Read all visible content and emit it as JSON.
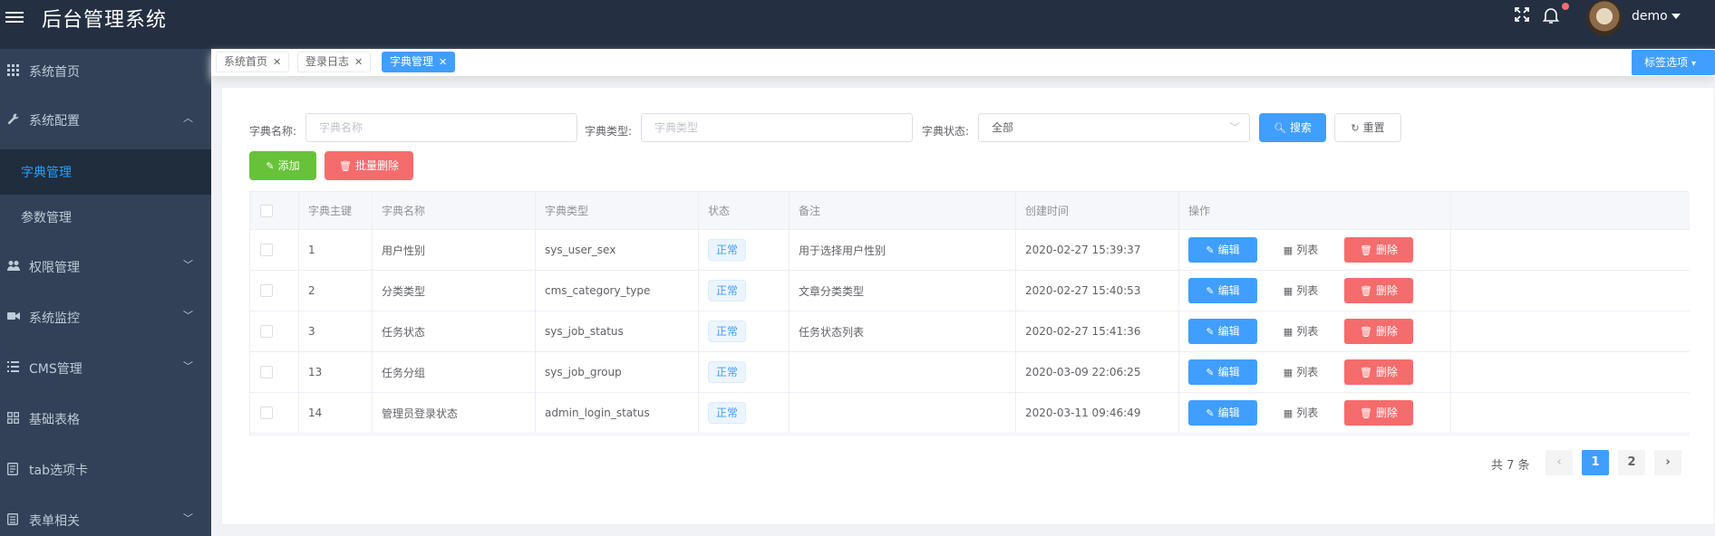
{
  "header": {
    "title": "后台管理系统",
    "username": "demo",
    "icons": [
      "menu-toggle-icon",
      "fullscreen-icon",
      "bell-icon",
      "avatar"
    ]
  },
  "sidebar": {
    "items": [
      {
        "label": "系统首页",
        "icon": "grid-icon"
      },
      {
        "label": "系统配置",
        "icon": "wrench-icon"
      },
      {
        "label": "字典管理"
      },
      {
        "label": "参数管理"
      },
      {
        "label": "权限管理",
        "icon": "users-icon"
      },
      {
        "label": "系统监控",
        "icon": "camera-icon"
      },
      {
        "label": "CMS管理",
        "icon": "list-icon"
      },
      {
        "label": "基础表格",
        "icon": "table-icon"
      },
      {
        "label": "tab选项卡",
        "icon": "document-icon"
      },
      {
        "label": "表单相关",
        "icon": "form-icon"
      }
    ]
  },
  "tags": {
    "items": [
      {
        "label": "系统首页"
      },
      {
        "label": "登录日志"
      },
      {
        "label": "字典管理"
      }
    ],
    "options_label": "标签选项"
  },
  "filters": {
    "name_label": "字典名称:",
    "name_placeholder": "字典名称",
    "type_label": "字典类型:",
    "type_placeholder": "字典类型",
    "status_label": "字典状态:",
    "status_value": "全部",
    "search_label": "搜索",
    "reset_label": "重置"
  },
  "actions": {
    "add_label": "添加",
    "batch_delete_label": "批量删除"
  },
  "table": {
    "headers": [
      "字典主键",
      "字典名称",
      "字典类型",
      "状态",
      "备注",
      "创建时间",
      "操作"
    ],
    "rows": [
      {
        "id": "1",
        "name": "用户性别",
        "type": "sys_user_sex",
        "status": "正常",
        "remark": "用于选择用户性别",
        "created": "2020-02-27 15:39:37"
      },
      {
        "id": "2",
        "name": "分类类型",
        "type": "cms_category_type",
        "status": "正常",
        "remark": "文章分类类型",
        "created": "2020-02-27 15:40:53"
      },
      {
        "id": "3",
        "name": "任务状态",
        "type": "sys_job_status",
        "status": "正常",
        "remark": "任务状态列表",
        "created": "2020-02-27 15:41:36"
      },
      {
        "id": "13",
        "name": "任务分组",
        "type": "sys_job_group",
        "status": "正常",
        "remark": "",
        "created": "2020-03-09 22:06:25"
      },
      {
        "id": "14",
        "name": "管理员登录状态",
        "type": "admin_login_status",
        "status": "正常",
        "remark": "",
        "created": "2020-03-11 09:46:49"
      }
    ],
    "op_edit": "编辑",
    "op_list": "列表",
    "op_delete": "删除"
  },
  "pagination": {
    "total_text": "共 7 条",
    "pages": [
      "1",
      "2"
    ],
    "current": "1"
  }
}
